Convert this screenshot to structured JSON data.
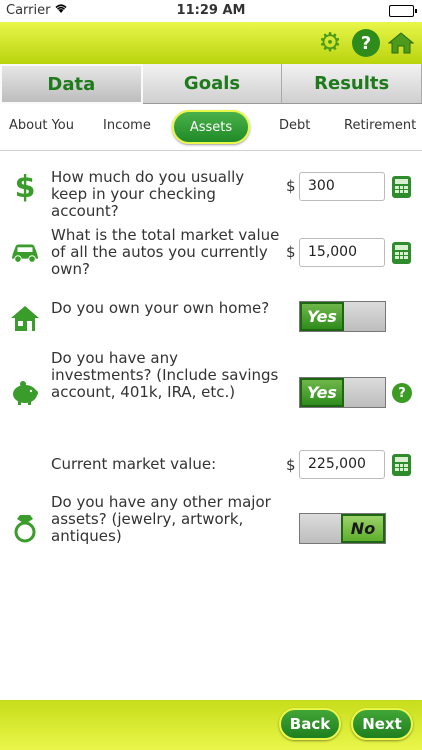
{
  "status_bar": {
    "carrier": "Carrier",
    "time": "11:29 AM"
  },
  "header": {
    "icons": [
      "gear-icon",
      "help-icon",
      "home-icon"
    ],
    "help_label": "?"
  },
  "tabs": [
    {
      "label": "Data",
      "active": true
    },
    {
      "label": "Goals",
      "active": false
    },
    {
      "label": "Results",
      "active": false
    }
  ],
  "subtabs": [
    {
      "label": "About You",
      "active": false
    },
    {
      "label": "Income",
      "active": false
    },
    {
      "label": "Assets",
      "active": true
    },
    {
      "label": "Debt",
      "active": false
    },
    {
      "label": "Retirement",
      "active": false
    }
  ],
  "questions": [
    {
      "icon": "dollar-icon",
      "text": "How much do you usually keep in your checking account?",
      "currency": "$",
      "value": "300"
    },
    {
      "icon": "car-icon",
      "text": "What is the total market value of all the autos you currently own?",
      "currency": "$",
      "value": "15,000"
    },
    {
      "icon": "house-icon",
      "text": "Do you own your own home?",
      "toggle": "Yes"
    },
    {
      "icon": "piggy-bank-icon",
      "text": "Do you have any investments? (Include savings account, 401k, IRA, etc.)",
      "toggle": "Yes",
      "help": "?"
    },
    {
      "text": "Current market value:",
      "currency": "$",
      "value": "225,000"
    },
    {
      "icon": "ring-icon",
      "text": "Do you have any other major assets? (jewelry, artwork, antiques)",
      "toggle": "No"
    }
  ],
  "footer": {
    "back": "Back",
    "next": "Next"
  },
  "colors": {
    "accent_yellow": "#e9f64a",
    "green": "#2e8c1c"
  }
}
